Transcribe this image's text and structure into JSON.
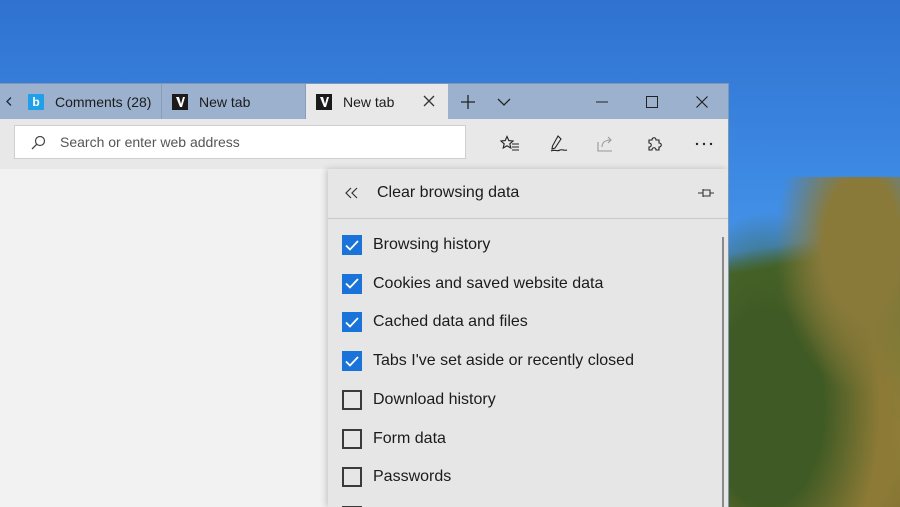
{
  "tabs": [
    {
      "label": "Comments (28)",
      "favicon": "b",
      "favicon_name": "bing-icon",
      "active": false
    },
    {
      "label": "New tab",
      "favicon": "M",
      "favicon_name": "edge-newtab-icon",
      "active": false
    },
    {
      "label": "New tab",
      "favicon": "M",
      "favicon_name": "edge-newtab-icon",
      "active": true
    }
  ],
  "address_bar": {
    "placeholder": "Search or enter web address",
    "value": ""
  },
  "toolbar_icons": [
    "favorites-icon",
    "web-note-icon",
    "share-icon",
    "extensions-icon",
    "more-icon"
  ],
  "panel": {
    "title": "Clear browsing data",
    "options": [
      {
        "label": "Browsing history",
        "checked": true
      },
      {
        "label": "Cookies and saved website data",
        "checked": true
      },
      {
        "label": "Cached data and files",
        "checked": true
      },
      {
        "label": "Tabs I've set aside or recently closed",
        "checked": true
      },
      {
        "label": "Download history",
        "checked": false
      },
      {
        "label": "Form data",
        "checked": false
      },
      {
        "label": "Passwords",
        "checked": false
      }
    ]
  },
  "colors": {
    "accent": "#1a73d9",
    "titlebar": "#9bb1ce",
    "toolbar": "#e8e8e8",
    "panel": "#e6e6e6"
  }
}
